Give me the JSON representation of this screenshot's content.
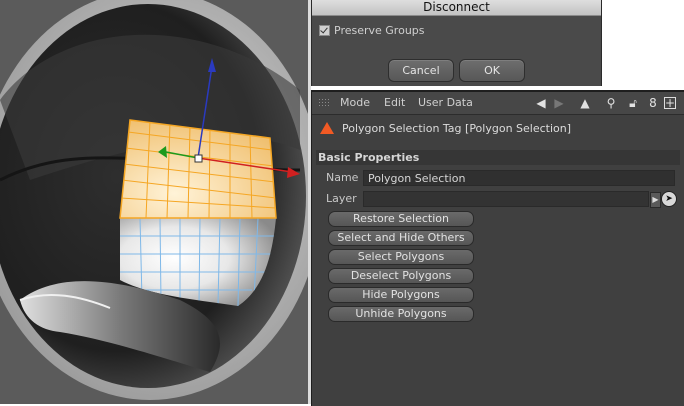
{
  "viewport": {
    "name": "3d-viewport"
  },
  "dialog": {
    "title": "Disconnect",
    "preserve_groups": {
      "label": "Preserve Groups",
      "checked": true
    },
    "cancel_label": "Cancel",
    "ok_label": "OK"
  },
  "attributes": {
    "menu": [
      "Mode",
      "Edit",
      "User Data"
    ],
    "tag_title": "Polygon Selection Tag [Polygon Selection]",
    "section": "Basic Properties",
    "name_label": "Name",
    "name_value": "Polygon Selection",
    "layer_label": "Layer",
    "layer_value": "",
    "buttons": [
      "Restore Selection",
      "Select and Hide Others",
      "Select Polygons",
      "Deselect Polygons",
      "Hide Polygons",
      "Unhide Polygons"
    ],
    "icons": [
      "back-arrow-icon",
      "forward-arrow-icon",
      "up-arrow-icon",
      "search-icon",
      "lock-icon",
      "link-icon",
      "new-panel-icon"
    ]
  },
  "colors": {
    "tag_accent": "#f25a24",
    "selection": "#f5a623",
    "axis_x": "#d02020",
    "axis_y": "#2a3ac0",
    "axis_z": "#1c9a1c"
  }
}
